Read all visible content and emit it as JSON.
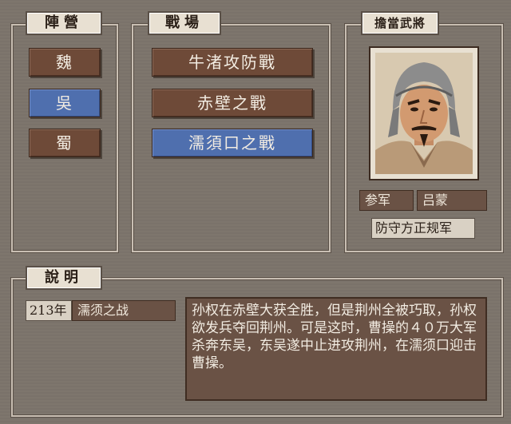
{
  "faction": {
    "title": "陣營",
    "items": [
      {
        "label": "魏",
        "selected": false
      },
      {
        "label": "吳",
        "selected": true
      },
      {
        "label": "蜀",
        "selected": false
      }
    ]
  },
  "battlefield": {
    "title": "戰場",
    "items": [
      {
        "label": "牛渚攻防戰",
        "selected": false
      },
      {
        "label": "赤壁之戰",
        "selected": false
      },
      {
        "label": "濡須口之戰",
        "selected": true
      }
    ]
  },
  "general": {
    "title": "擔當武將",
    "rank": "参军",
    "name": "吕蒙",
    "unit": "防守方正规军"
  },
  "info": {
    "title": "說明",
    "year": "213年",
    "battle_name": "濡须之战",
    "description": "孙权在赤壁大获全胜，但是荆州全被巧取，孙权欲发兵夺回荆州。可是这时，曹操的４０万大军杀奔东吴，东吴遂中止进攻荆州，在濡须口迎击曹操。"
  }
}
